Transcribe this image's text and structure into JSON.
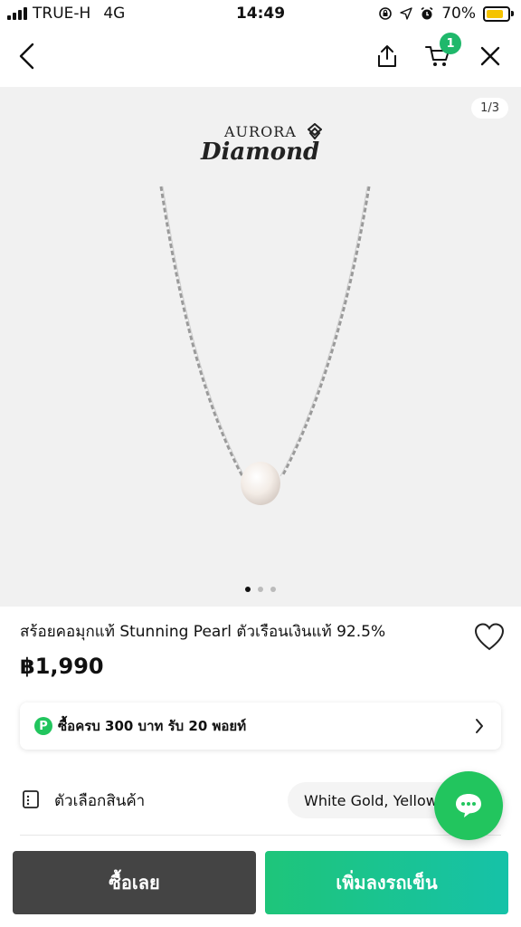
{
  "status_bar": {
    "carrier": "TRUE-H",
    "network": "4G",
    "time": "14:49",
    "battery": "70%"
  },
  "nav": {
    "cart_badge": "1"
  },
  "gallery": {
    "counter": "1/3",
    "brand_top": "AURORA",
    "brand_bottom": "Diamond",
    "dot_count": 3,
    "active_dot": 1
  },
  "product": {
    "title": "สร้อยคอมุกแท้ Stunning Pearl ตัวเรือนเงินแท้ 92.5%",
    "price": "฿1,990"
  },
  "points": {
    "icon": "P",
    "text": "ซื้อครบ 300 บาท รับ 20 พอยท์"
  },
  "options": {
    "label": "ตัวเลือกสินค้า",
    "value": "White Gold, Yellow"
  },
  "actions": {
    "buy_now": "ซื้อเลย",
    "add_to_cart": "เพิ่มลงรถเข็น"
  },
  "colors": {
    "accent_green": "#22c55e",
    "buy_button": "#444444"
  }
}
